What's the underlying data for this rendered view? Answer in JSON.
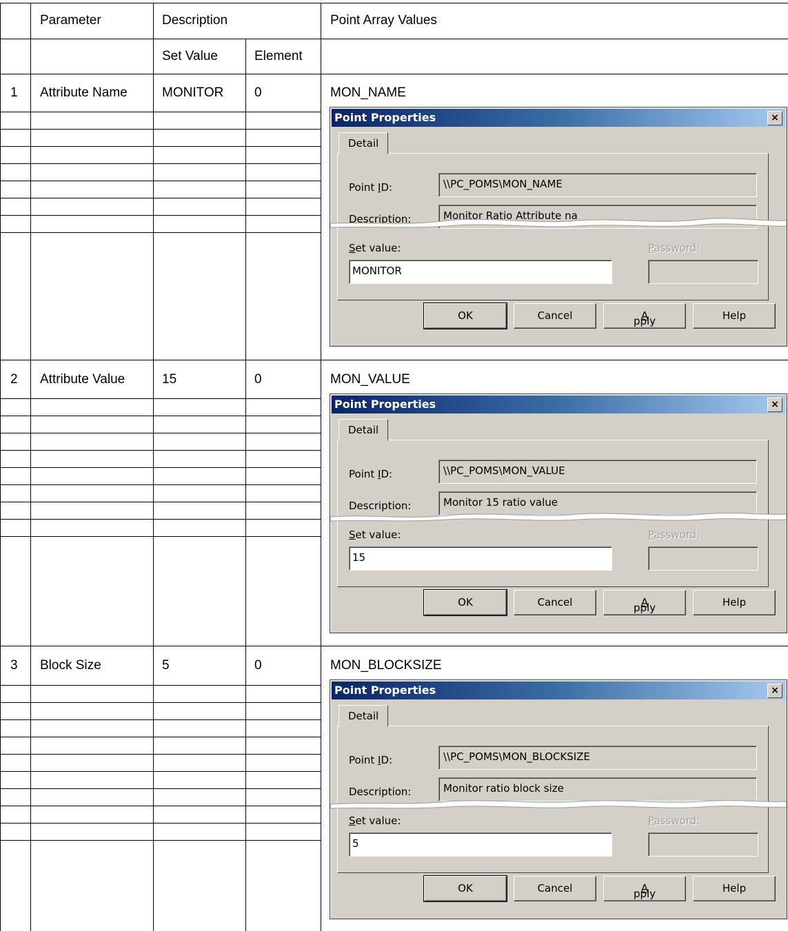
{
  "table": {
    "header": {
      "parameter": "Parameter",
      "description": "Description",
      "point_array_values": "Point Array Values"
    },
    "subheader": {
      "set_value": "Set Value",
      "element": "Element"
    },
    "rows": [
      {
        "num": "1",
        "parameter": "Attribute Name",
        "set_value": "MONITOR",
        "element": "0",
        "point_name": "MON_NAME"
      },
      {
        "num": "2",
        "parameter": "Attribute Value",
        "set_value": "15",
        "element": "0",
        "point_name": "MON_VALUE"
      },
      {
        "num": "3",
        "parameter": "Block Size",
        "set_value": "5",
        "element": "0",
        "point_name": "MON_BLOCKSIZE"
      }
    ]
  },
  "dialogs": [
    {
      "title": "Point Properties",
      "close_glyph": "×",
      "tab": "Detail",
      "point_id_label_pre": "Point ",
      "point_id_label_u": "I",
      "point_id_label_post": "D:",
      "point_id": "\\\\PC_POMS\\MON_NAME",
      "description_label": "Description:",
      "description": "Monitor Ratio Attribute na",
      "set_value_label_u": "S",
      "set_value_label_post": "et value:",
      "set_value": "MONITOR",
      "password_label_u": "P",
      "password_label_post": "assword:",
      "ok": "OK",
      "cancel": "Cancel",
      "apply_u": "A",
      "apply_post": "pply",
      "help": "Help"
    },
    {
      "title": "Point Properties",
      "close_glyph": "×",
      "tab": "Detail",
      "point_id_label_pre": "Point ",
      "point_id_label_u": "I",
      "point_id_label_post": "D:",
      "point_id": "\\\\PC_POMS\\MON_VALUE",
      "description_label": "Description:",
      "description": "Monitor 15 ratio value",
      "set_value_label_u": "S",
      "set_value_label_post": "et value:",
      "set_value": "15",
      "password_label_u": "P",
      "password_label_post": "assword:",
      "ok": "OK",
      "cancel": "Cancel",
      "apply_u": "A",
      "apply_post": "pply",
      "help": "Help"
    },
    {
      "title": "Point Properties",
      "close_glyph": "×",
      "tab": "Detail",
      "point_id_label_pre": "Point ",
      "point_id_label_u": "I",
      "point_id_label_post": "D:",
      "point_id": "\\\\PC_POMS\\MON_BLOCKSIZE",
      "description_label": "Description:",
      "description": "Monitor ratio block size",
      "set_value_label_u": "S",
      "set_value_label_post": "et value:",
      "set_value": "5",
      "password_label_u": "P",
      "password_label_post": "assword:",
      "ok": "OK",
      "cancel": "Cancel",
      "apply_u": "A",
      "apply_post": "pply",
      "help": "Help"
    }
  ]
}
